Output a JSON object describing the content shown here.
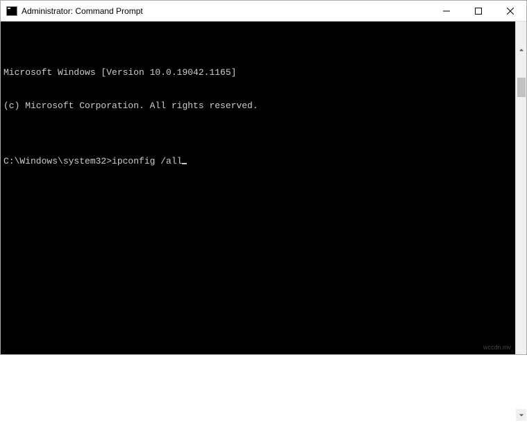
{
  "titlebar": {
    "title": "Administrator: Command Prompt"
  },
  "terminal": {
    "line1": "Microsoft Windows [Version 10.0.19042.1165]",
    "line2": "(c) Microsoft Corporation. All rights reserved.",
    "blank": "",
    "prompt": "C:\\Windows\\system32>",
    "command": "ipconfig /all"
  },
  "watermark": "wccdn.mv"
}
